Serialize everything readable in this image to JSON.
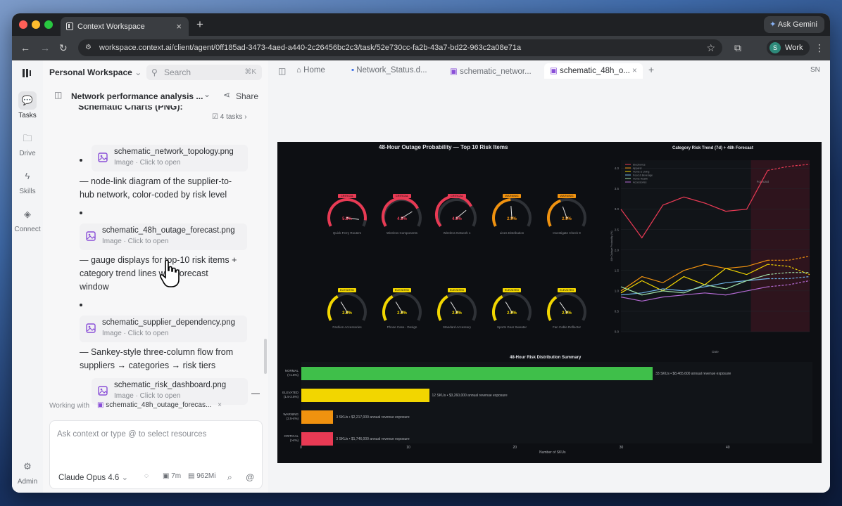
{
  "browser": {
    "tab_title": "Context Workspace",
    "gemini_label": "Ask Gemini",
    "url": "workspace.context.ai/client/agent/0ff185ad-3473-4aed-a440-2c26456bc2c3/task/52e730cc-fa2b-43a7-bd22-963c2a08e71a",
    "profile_initial": "S",
    "profile_label": "Work"
  },
  "rail": {
    "items": [
      {
        "label": "Tasks"
      },
      {
        "label": "Drive"
      },
      {
        "label": "Skills"
      },
      {
        "label": "Connect"
      }
    ],
    "admin_label": "Admin"
  },
  "left": {
    "workspace": "Personal Workspace",
    "search_placeholder": "Search",
    "search_shortcut": "⌘K",
    "chat_title": "Network performance analysis ...",
    "share_label": "Share",
    "section_heading": "Schematic Charts (PNG):",
    "tasks_count": "4 tasks",
    "files": [
      {
        "name": "schematic_network_topology.png",
        "sub": "Image · Click to open"
      },
      {
        "name": "schematic_48h_outage_forecast.png",
        "sub": "Image · Click to open"
      },
      {
        "name": "schematic_supplier_dependency.png",
        "sub": "Image · Click to open"
      },
      {
        "name": "schematic_risk_dashboard.png",
        "sub": "Image · Click to open"
      }
    ],
    "desc_1": [
      "— node-link diagram of the supplier-to-",
      "hub network, color-coded by risk level"
    ],
    "desc_2": [
      "— gauge displays for top-10 risk items +",
      "category trend lines with forecast",
      "window"
    ],
    "desc_3": [
      "— Sankey-style three-column flow from",
      "suppliers → categories → risk tiers"
    ],
    "trailing_dash": "—",
    "working_with_label": "Working with",
    "working_with_file": "schematic_48h_outage_forecas...",
    "composer_placeholder": "Ask context or type @ to select resources",
    "model": "Claude Opus 4.6",
    "elapsed": "7m",
    "tokens": "962Mi"
  },
  "right": {
    "home_label": "Home",
    "tabs": [
      "Network_Status.d...",
      "schematic_networ...",
      "schematic_48h_o..."
    ],
    "user_initials": "SN"
  },
  "figure": {
    "title": "48-Hour Outage Probability — Top 10 Risk Items",
    "trend_title": "Category Risk Trend (7d) + 48h Forecast",
    "dist_title": "48-Hour Risk Distribution Summary",
    "dist_xlabel": "Number of SKUs",
    "trend_xlabel": "Date",
    "trend_ylabel": "48h Outage Probability (%)",
    "forecast_label": "Forecast",
    "colors": {
      "critical": "#e83a54",
      "warning": "#f0920f",
      "elevated": "#f2d600",
      "normal": "#3fbf4a"
    },
    "gauges": [
      {
        "badge": "CRITICAL",
        "value": "5.5%",
        "label": "Quick Ferry Routers"
      },
      {
        "badge": "CRITICAL",
        "value": "4.5%",
        "label": "Wireless Components"
      },
      {
        "badge": "CRITICAL",
        "value": "4.3%",
        "label": "Wireless Network 1"
      },
      {
        "badge": "WARNING",
        "value": "2.9%",
        "label": "Lines Distribution"
      },
      {
        "badge": "WARNING",
        "value": "2.5%",
        "label": "Investigate Check 9"
      },
      {
        "badge": "ELEVATED",
        "value": "2.2%",
        "label": "Fashion Accessories"
      },
      {
        "badge": "ELEVATED",
        "value": "2.2%",
        "label": "Phone Case - Design"
      },
      {
        "badge": "ELEVATED",
        "value": "2.2%",
        "label": "Standard Accessory"
      },
      {
        "badge": "ELEVATED",
        "value": "2.2%",
        "label": "Sports Gear Sweater"
      },
      {
        "badge": "ELEVATED",
        "value": "2.1%",
        "label": "Fan Cable Reflector"
      }
    ],
    "legend": [
      "Electronics",
      "Apparel",
      "Home & Living",
      "Food & Beverage",
      "Home Health",
      "Accessories"
    ]
  },
  "chart_data": [
    {
      "type": "line",
      "title": "Category Risk Trend (7d) + 48h Forecast",
      "xlabel": "Date",
      "ylabel": "48h Outage Probability (%)",
      "ylim": [
        0,
        4.2
      ],
      "series": [
        {
          "name": "Electronics",
          "color": "#e83a54",
          "values": [
            3.0,
            2.3,
            3.1,
            3.3,
            3.15,
            2.95,
            3.0,
            3.95,
            4.05,
            4.1
          ]
        },
        {
          "name": "Apparel",
          "color": "#f0920f",
          "values": [
            1.0,
            1.35,
            1.2,
            1.5,
            1.65,
            1.55,
            1.6,
            1.75,
            1.75,
            1.85
          ]
        },
        {
          "name": "Home & Living",
          "color": "#f2d600",
          "values": [
            0.95,
            1.25,
            1.0,
            1.35,
            1.15,
            1.55,
            1.4,
            1.65,
            1.6,
            1.4
          ]
        },
        {
          "name": "Food & Beverage",
          "color": "#6fb3e8",
          "values": [
            0.9,
            0.95,
            1.05,
            1.0,
            1.1,
            1.2,
            1.25,
            1.3,
            1.3,
            1.35
          ]
        },
        {
          "name": "Home Health",
          "color": "#9fe0a8",
          "values": [
            1.1,
            0.9,
            1.0,
            0.95,
            1.15,
            1.05,
            1.25,
            1.4,
            1.45,
            1.45
          ]
        },
        {
          "name": "Accessories",
          "color": "#b46ad4",
          "values": [
            0.85,
            0.75,
            0.85,
            0.9,
            0.95,
            0.9,
            1.0,
            1.1,
            1.15,
            1.25
          ]
        }
      ]
    },
    {
      "type": "bar",
      "title": "48-Hour Risk Distribution Summary",
      "xlabel": "Number of SKUs",
      "categories": [
        "NORMAL (<1.5%)",
        "ELEVATED (1.5-2.5%)",
        "WARNING (2.5-4%)",
        "CRITICAL (>4%)"
      ],
      "values": [
        33,
        12,
        3,
        3
      ],
      "notes": [
        "33 SKUs • $8,465,600 annual revenue exposure",
        "12 SKUs • $3,260,000 annual revenue exposure",
        "3 SKUs • $2,217,000 annual revenue exposure",
        "3 SKUs • $1,746,000 annual revenue exposure"
      ],
      "xticks": [
        0,
        10,
        20,
        30,
        40
      ],
      "xlim": [
        0,
        48
      ]
    }
  ]
}
